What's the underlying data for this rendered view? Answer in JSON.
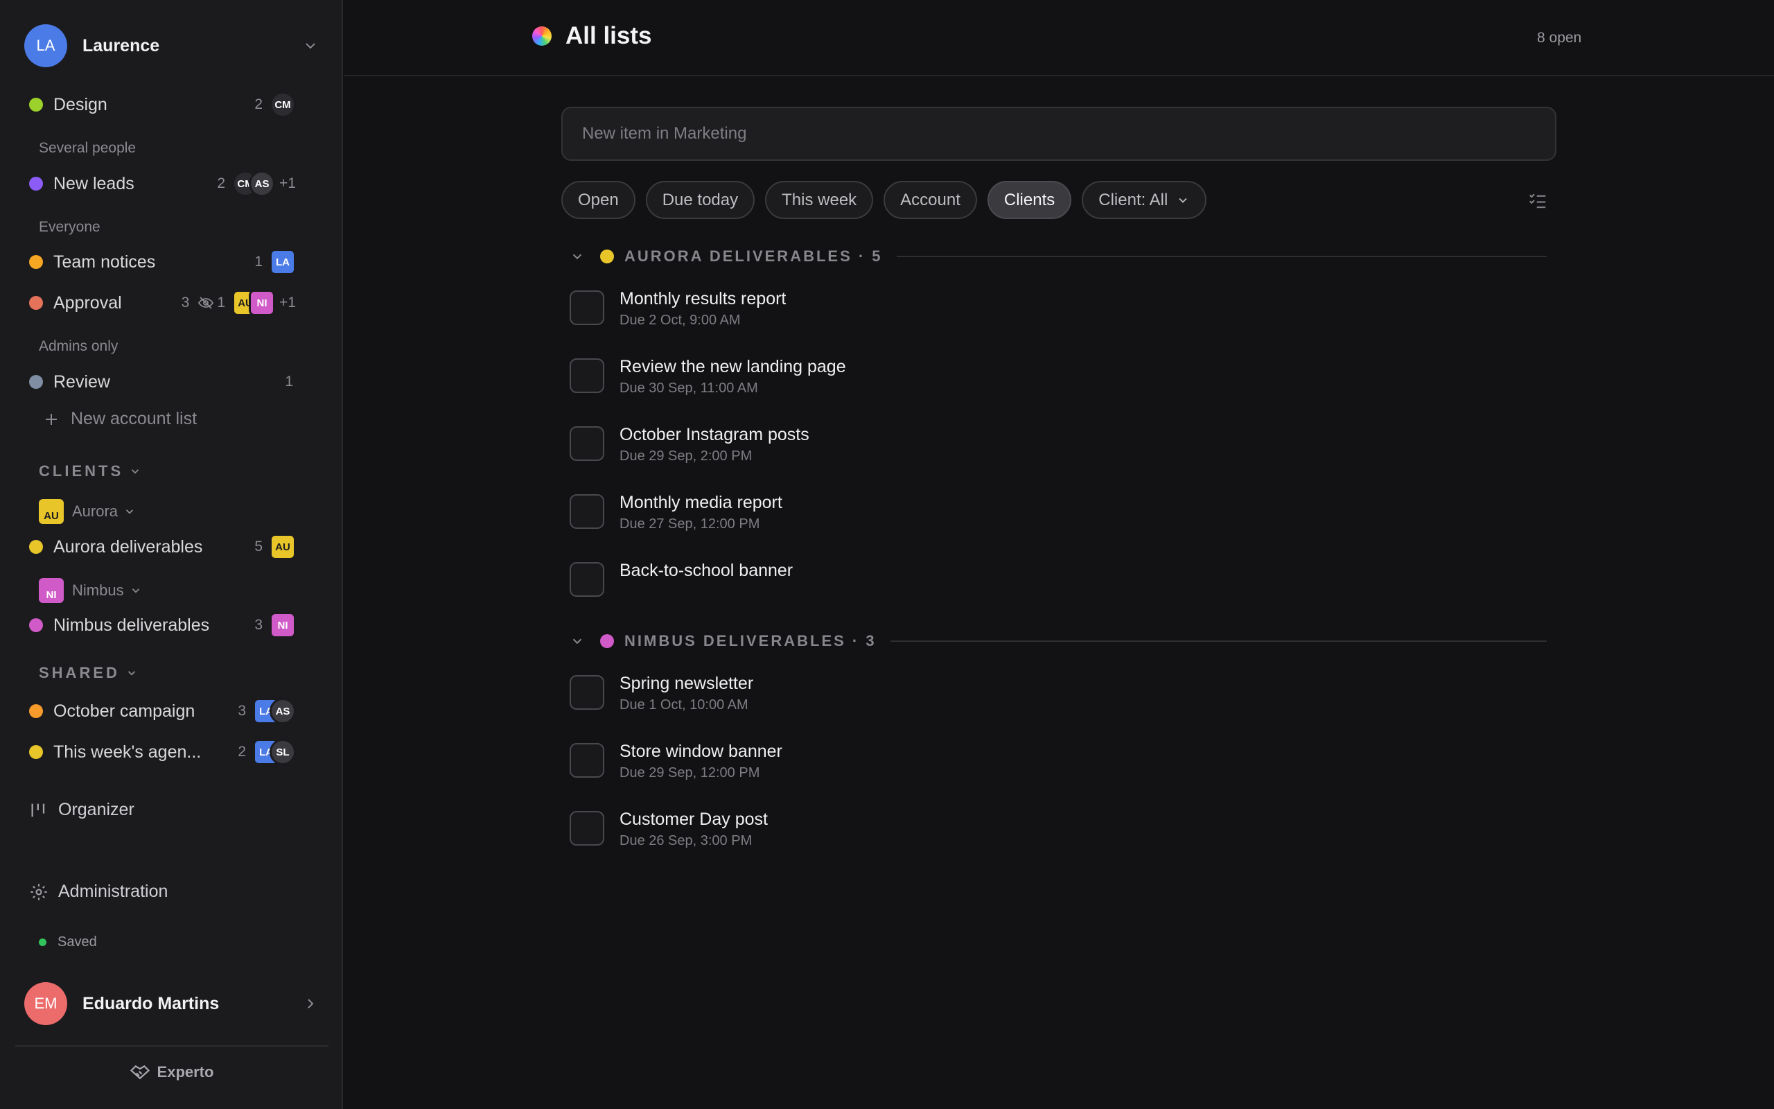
{
  "account": {
    "name": "Laurence",
    "initials": "LA",
    "color": "#4a7be6"
  },
  "sidebar": {
    "design": {
      "label": "Design",
      "count": "2",
      "avatar": "CM",
      "color": "#9bd12a"
    },
    "several_people_label": "Several people",
    "new_leads": {
      "label": "New leads",
      "count": "2",
      "avatars": [
        "CM",
        "AS"
      ],
      "more": "+1",
      "color": "#8b5cf6"
    },
    "everyone_label": "Everyone",
    "team_notices": {
      "label": "Team notices",
      "count": "1",
      "avatar": "LA",
      "color": "#f5a623"
    },
    "approval": {
      "label": "Approval",
      "count": "3",
      "hidden_count": "1",
      "avatars": [
        "AU",
        "NI"
      ],
      "more": "+1",
      "color": "#e5735a"
    },
    "admins_label": "Admins only",
    "review": {
      "label": "Review",
      "count": "1",
      "color": "#7f8ea3"
    },
    "new_account_list": "New account list",
    "clients_section": "CLIENTS",
    "aurora_client": {
      "badge": "AU",
      "name": "Aurora",
      "color": "#e8c62a"
    },
    "aurora_deliverables": {
      "label": "Aurora deliverables",
      "count": "5",
      "avatar": "AU",
      "color": "#e8c62a"
    },
    "nimbus_client": {
      "badge": "NI",
      "name": "Nimbus",
      "color": "#d05bc8"
    },
    "nimbus_deliverables": {
      "label": "Nimbus deliverables",
      "count": "3",
      "avatar": "NI",
      "color": "#d05bc8"
    },
    "shared_section": "SHARED",
    "october_campaign": {
      "label": "October campaign",
      "count": "3",
      "avatars": [
        "LA",
        "AS"
      ],
      "color": "#f59a2b"
    },
    "weeks_agenda": {
      "label": "This week's agen...",
      "count": "2",
      "avatars": [
        "LA",
        "SL"
      ],
      "color": "#e8c62a"
    },
    "organizer": "Organizer",
    "administration": "Administration",
    "saved_status": "Saved",
    "user": {
      "name": "Eduardo Martins",
      "initials": "EM",
      "color": "#ec6b6b"
    },
    "brand": "Experto"
  },
  "header": {
    "title": "All lists",
    "open_count": "8 open"
  },
  "new_item": {
    "placeholder": "New item in Marketing"
  },
  "filters": {
    "chips": [
      "Open",
      "Due today",
      "This week",
      "Account",
      "Clients"
    ],
    "active": "Clients",
    "client_select": "Client: All"
  },
  "groups": [
    {
      "title": "AURORA DELIVERABLES · 5",
      "color": "#e8c62a",
      "tasks": [
        {
          "title": "Monthly results report",
          "due": "Due 2 Oct, 9:00 AM"
        },
        {
          "title": "Review the new landing page",
          "due": "Due 30 Sep, 11:00 AM"
        },
        {
          "title": "October Instagram posts",
          "due": "Due 29 Sep, 2:00 PM"
        },
        {
          "title": "Monthly media report",
          "due": "Due 27 Sep, 12:00 PM"
        },
        {
          "title": "Back-to-school banner",
          "due": ""
        }
      ]
    },
    {
      "title": "NIMBUS DELIVERABLES · 3",
      "color": "#d05bc8",
      "tasks": [
        {
          "title": "Spring newsletter",
          "due": "Due 1 Oct, 10:00 AM"
        },
        {
          "title": "Store window banner",
          "due": "Due 29 Sep, 12:00 PM"
        },
        {
          "title": "Customer Day post",
          "due": "Due 26 Sep, 3:00 PM"
        }
      ]
    }
  ]
}
